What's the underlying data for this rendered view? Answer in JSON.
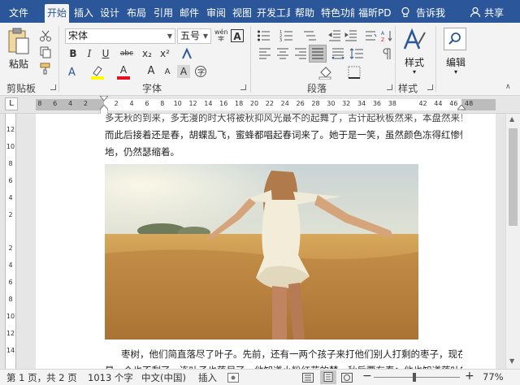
{
  "tabs": [
    {
      "label": "文件",
      "active": false
    },
    {
      "label": "开始",
      "active": true
    },
    {
      "label": "插入",
      "active": false
    },
    {
      "label": "设计",
      "active": false
    },
    {
      "label": "布局",
      "active": false
    },
    {
      "label": "引用",
      "active": false
    },
    {
      "label": "邮件",
      "active": false
    },
    {
      "label": "审阅",
      "active": false
    },
    {
      "label": "视图",
      "active": false
    },
    {
      "label": "开发工具",
      "active": false
    },
    {
      "label": "帮助",
      "active": false
    },
    {
      "label": "特色功能",
      "active": false
    },
    {
      "label": "福昕PD",
      "active": false
    }
  ],
  "tell_me": "告诉我",
  "share": "共享",
  "ribbon": {
    "clipboard": {
      "label": "剪贴板",
      "paste": "粘贴"
    },
    "font": {
      "label": "字体",
      "name": "宋体",
      "size": "五号",
      "phonetic": "wén",
      "bold": "B",
      "italic": "I",
      "underline": "U",
      "strike": "abc",
      "sub": "x₂",
      "sup": "x²",
      "grow": "A",
      "clear": "A",
      "color_a": "A",
      "charborder": "A",
      "charshade": "A",
      "enclose": "字"
    },
    "paragraph": {
      "label": "段落"
    },
    "styles": {
      "label": "样式",
      "button": "样式"
    },
    "editing": {
      "button": "编辑"
    }
  },
  "ruler": {
    "ticks": [
      "8",
      "6",
      "4",
      "2",
      "",
      "2",
      "4",
      "6",
      "8",
      "10",
      "12",
      "14",
      "16",
      "18",
      "20",
      "22",
      "24",
      "26",
      "28",
      "30",
      "32",
      "34",
      "36",
      "38",
      "",
      "42",
      "44",
      "46",
      "48"
    ]
  },
  "vruler": {
    "ticks": [
      "12",
      "10",
      "8",
      "6",
      "4",
      "2",
      "",
      "2",
      "4",
      "6",
      "8",
      "10",
      "12",
      "14"
    ]
  },
  "document": {
    "line1": "多无秋的到来，多无漫的时大将被秋抑风光最不的起舞了，古计起秋板然来，本盘然来！",
    "line2": "而此后接着还是春，胡蝶乱飞，蜜蜂都唱起春词来了。她于是一笑，虽然颜色冻得红惨惨",
    "line3": "地，仍然瑟缩着。",
    "line4": "枣树，他们简直落尽了叶子。先前，还有一两个孩子来打他们别人打剩的枣子，现在",
    "line5": "是一个也不剩了，连叶子也落尽了。他知道小粉红花的梦，秋后要有春；他也知道落叶的梦"
  },
  "colors": {
    "accent": "#2b579a",
    "highlight": "#ffff00",
    "fontcolor": "#e81123"
  },
  "status": {
    "page": "第 1 页，共 2 页",
    "words": "1013 个字",
    "lang": "中文(中国)",
    "mode": "插入",
    "zoom": "77%",
    "zoom_minus": "−",
    "zoom_plus": "+"
  }
}
